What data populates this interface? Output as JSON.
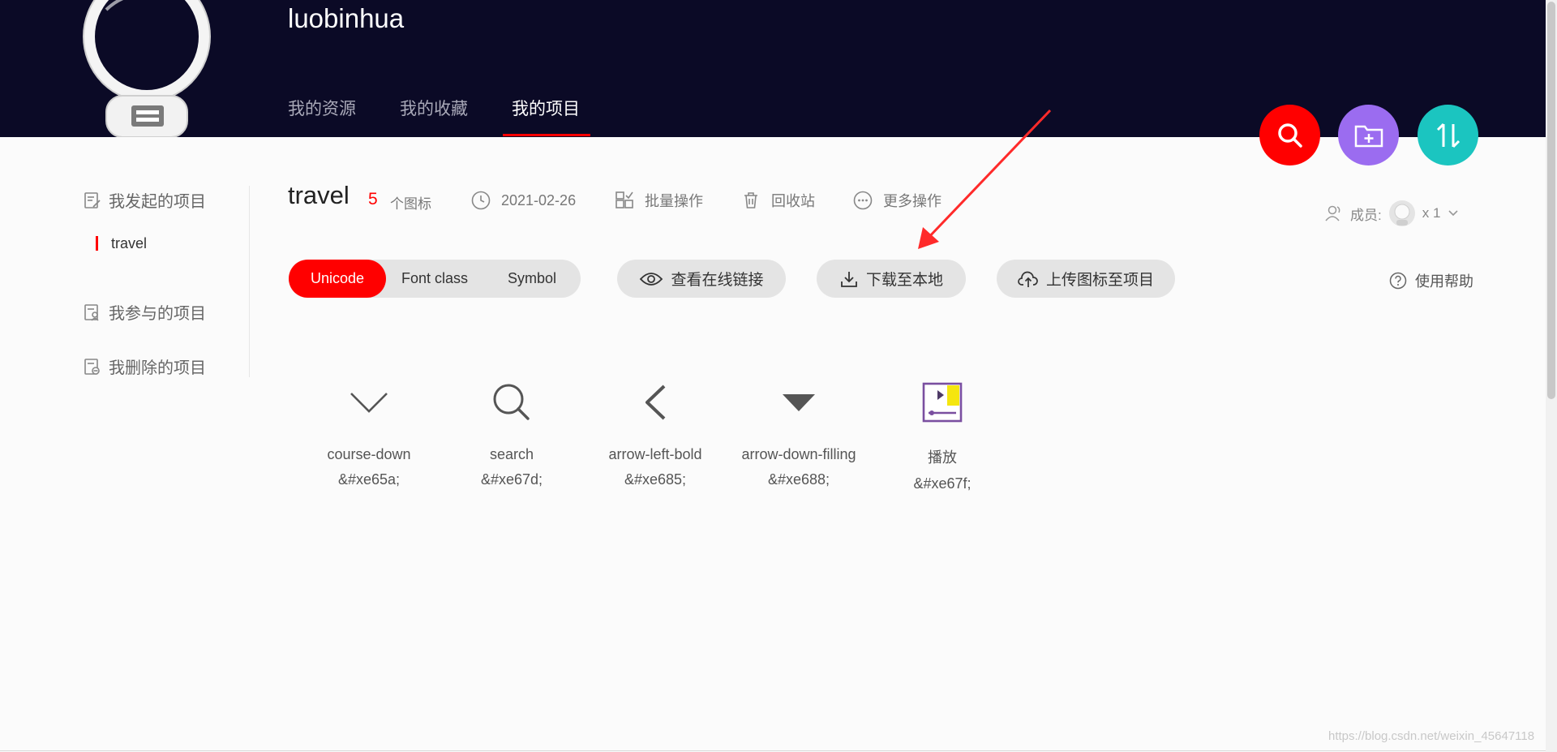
{
  "header": {
    "username": "luobinhua",
    "tabs": [
      {
        "label": "我的资源"
      },
      {
        "label": "我的收藏"
      },
      {
        "label": "我的项目",
        "active": true
      }
    ],
    "actions": [
      {
        "name": "search",
        "icon": "search-icon",
        "color": "#ff0000"
      },
      {
        "name": "new-folder",
        "icon": "folder-add-icon",
        "color": "#9b6cf0"
      },
      {
        "name": "sort",
        "icon": "sort-arrows-icon",
        "color": "#1bc5c0"
      }
    ]
  },
  "sidebar": {
    "items": [
      {
        "label": "我发起的项目",
        "icon": "project-edit-icon"
      },
      {
        "label": "我参与的项目",
        "icon": "project-member-icon"
      },
      {
        "label": "我删除的项目",
        "icon": "project-deleted-icon"
      }
    ],
    "active_project": "travel"
  },
  "project": {
    "name": "travel",
    "count": "5",
    "count_unit": "个图标",
    "date": "2021-02-26",
    "batch": "批量操作",
    "recycle": "回收站",
    "more": "更多操作",
    "member_label": "成员:",
    "member_count": "x 1"
  },
  "toolbar": {
    "formats": [
      "Unicode",
      "Font class",
      "Symbol"
    ],
    "active_format": "Unicode",
    "view_link": "查看在线链接",
    "download": "下载至本地",
    "upload": "上传图标至项目",
    "help": "使用帮助"
  },
  "icons": [
    {
      "name": "course-down",
      "code": "&#xe65a;",
      "glyph": "chevron-down-icon"
    },
    {
      "name": "search",
      "code": "&#xe67d;",
      "glyph": "search-icon"
    },
    {
      "name": "arrow-left-bold",
      "code": "&#xe685;",
      "glyph": "chevron-left-icon"
    },
    {
      "name": "arrow-down-filling",
      "code": "&#xe688;",
      "glyph": "triangle-down-icon"
    },
    {
      "name": "播放",
      "code": "&#xe67f;",
      "glyph": "play-video-icon"
    }
  ],
  "watermark": "https://blog.csdn.net/weixin_45647118",
  "colors": {
    "header_bg": "#0b0a26",
    "accent": "#ff0000",
    "purple": "#9b6cf0",
    "teal": "#1bc5c0",
    "annotation_arrow": "#ff2a2a"
  }
}
